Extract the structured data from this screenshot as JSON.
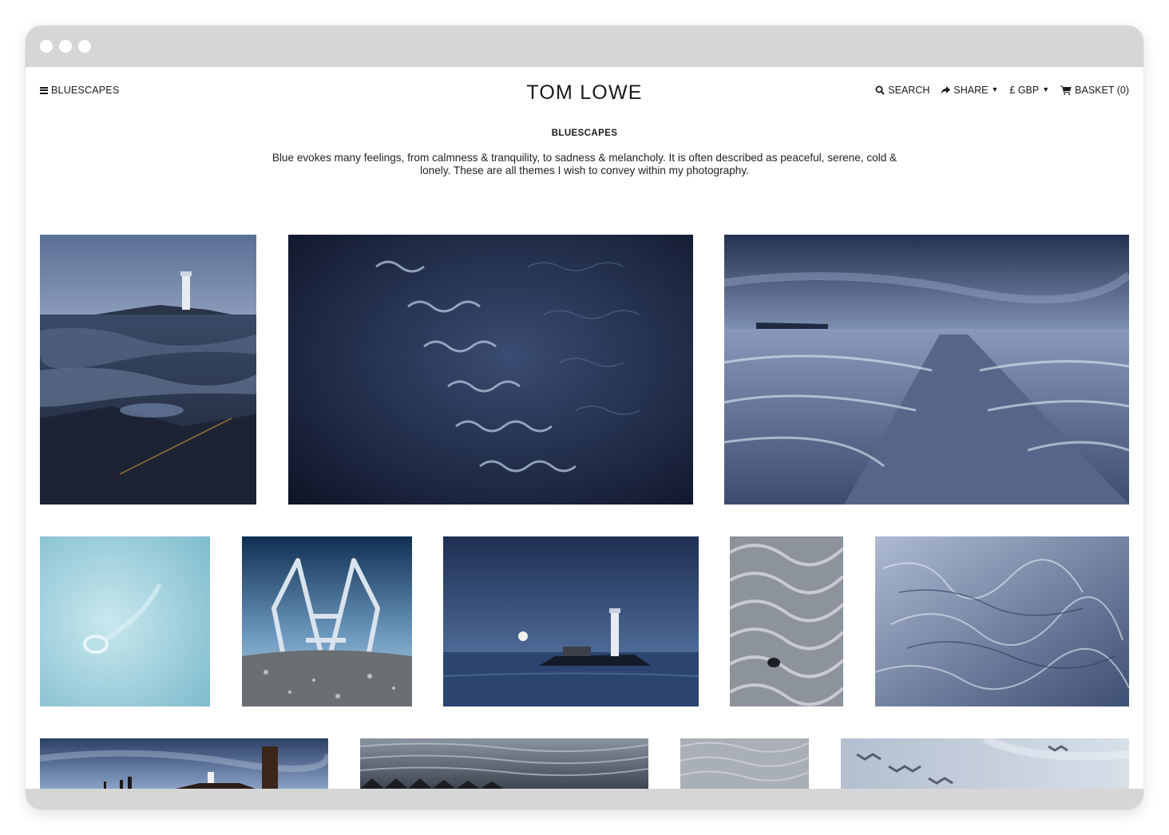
{
  "nav": {
    "menu_label": "BLUESCAPES",
    "site_title": "TOM LOWE",
    "search_label": "SEARCH",
    "share_label": "SHARE",
    "currency_label": "£ GBP",
    "basket_label": "BASKET (0)"
  },
  "gallery": {
    "heading": "BLUESCAPES",
    "description": "Blue evokes many feelings, from calmness & tranquility, to sadness & melancholy. It is often described as peaceful, serene, cold & lonely. These are all themes I wish to convey within my photography."
  },
  "icons": {
    "menu": "hamburger-icon",
    "search": "search-icon",
    "share": "share-icon",
    "dropdown": "chevron-down-icon",
    "basket": "cart-icon"
  },
  "photos": [
    {
      "subject": "lighthouse-on-rocks",
      "tone": "#4a5e80"
    },
    {
      "subject": "dark-sand-ripples",
      "tone": "#1b2740"
    },
    {
      "subject": "pier-in-waves",
      "tone": "#6b7ea3"
    },
    {
      "subject": "pale-blue-ice",
      "tone": "#a9d6e2"
    },
    {
      "subject": "pool-ladder",
      "tone": "#2f5578"
    },
    {
      "subject": "lighthouse-with-moon",
      "tone": "#27406a"
    },
    {
      "subject": "sand-ripples-stone",
      "tone": "#9a9fa7"
    },
    {
      "subject": "frosted-texture",
      "tone": "#8ea0c0"
    },
    {
      "subject": "lighthouse-with-posts",
      "tone": "#4c6a9c"
    },
    {
      "subject": "grey-sand-ridges",
      "tone": "#6b7480"
    },
    {
      "subject": "fine-sand",
      "tone": "#aeb4bb"
    },
    {
      "subject": "sand-patterns",
      "tone": "#c2ccd8"
    }
  ]
}
